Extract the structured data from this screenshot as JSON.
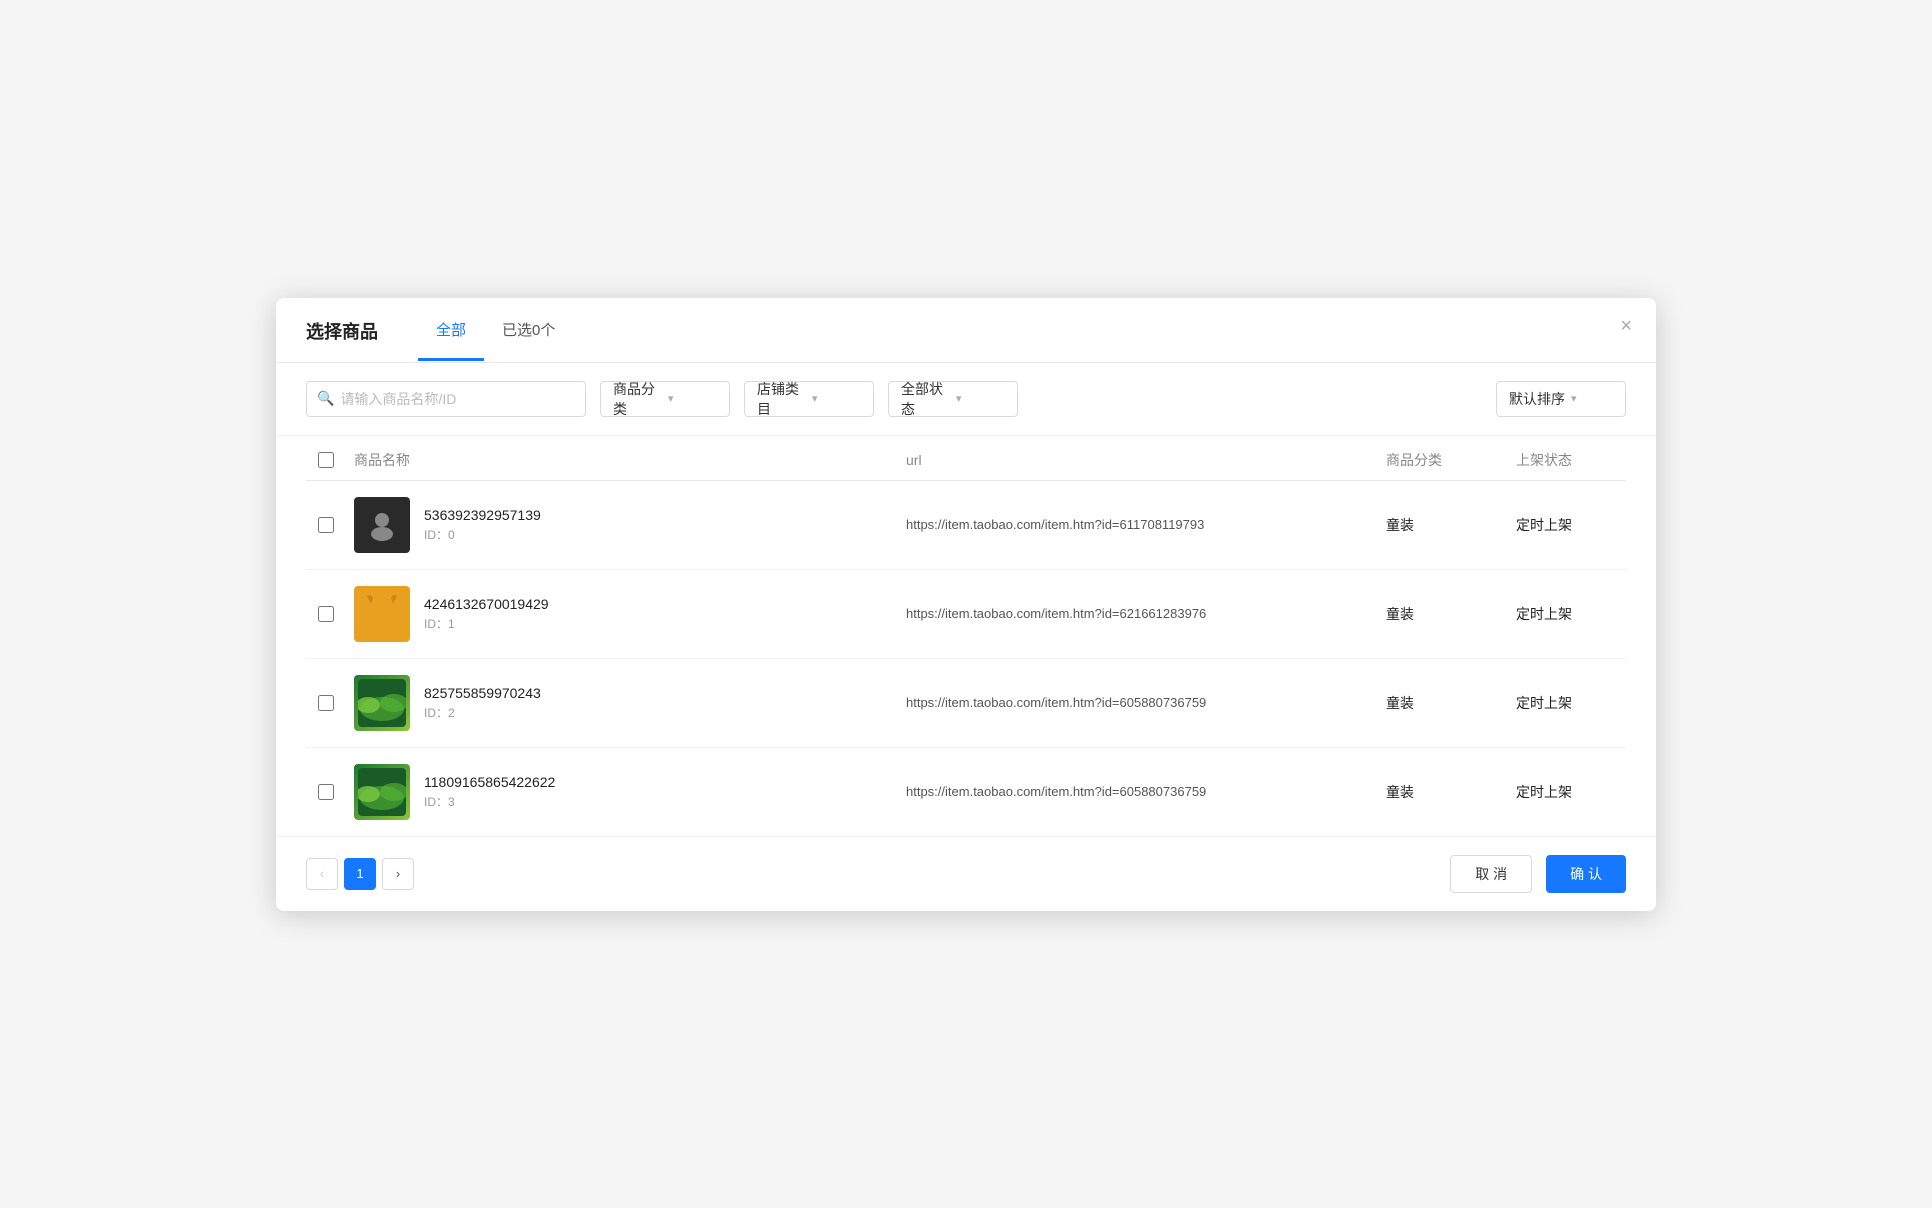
{
  "modal": {
    "title": "选择商品",
    "close_label": "×"
  },
  "tabs": [
    {
      "id": "all",
      "label": "全部",
      "active": true
    },
    {
      "id": "selected",
      "label": "已选0个",
      "active": false
    }
  ],
  "filters": {
    "search_placeholder": "请输入商品名称/ID",
    "category_label": "商品分类",
    "store_label": "店铺类目",
    "status_label": "全部状态",
    "sort_label": "默认排序"
  },
  "table": {
    "columns": [
      {
        "id": "check",
        "label": ""
      },
      {
        "id": "name",
        "label": "商品名称"
      },
      {
        "id": "url",
        "label": "url"
      },
      {
        "id": "category",
        "label": "商品分类"
      },
      {
        "id": "status",
        "label": "上架状态"
      }
    ],
    "rows": [
      {
        "id": 0,
        "name": "536392392957139",
        "product_id": "ID：0",
        "url": "https://item.taobao.com/item.htm?id=611708119793",
        "category": "童装",
        "status": "定时上架",
        "thumb_type": "dark"
      },
      {
        "id": 1,
        "name": "4246132670019429",
        "product_id": "ID：1",
        "url": "https://item.taobao.com/item.htm?id=621661283976",
        "category": "童装",
        "status": "定时上架",
        "thumb_type": "yellow"
      },
      {
        "id": 2,
        "name": "825755859970243",
        "product_id": "ID：2",
        "url": "https://item.taobao.com/item.htm?id=605880736759",
        "category": "童装",
        "status": "定时上架",
        "thumb_type": "green"
      },
      {
        "id": 3,
        "name": "11809165865422622",
        "product_id": "ID：3",
        "url": "https://item.taobao.com/item.htm?id=605880736759",
        "category": "童装",
        "status": "定时上架",
        "thumb_type": "green"
      }
    ]
  },
  "pagination": {
    "prev_label": "‹",
    "next_label": "›",
    "current_page": "1"
  },
  "footer": {
    "cancel_label": "取 消",
    "confirm_label": "确 认"
  }
}
